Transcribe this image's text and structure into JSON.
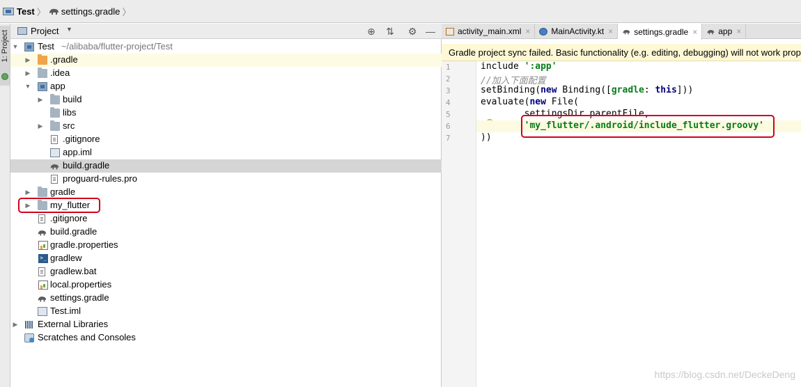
{
  "breadcrumb": {
    "project": "Test",
    "file": "settings.gradle"
  },
  "tool_strip": {
    "project_tab": "1: Project"
  },
  "project_panel": {
    "title": "Project",
    "tree": [
      {
        "label": "Test",
        "path": "~/alibaba/flutter-project/Test",
        "icon": "module-icon"
      },
      {
        "label": ".gradle",
        "icon": "folder-icon"
      },
      {
        "label": ".idea",
        "icon": "folder-icon"
      },
      {
        "label": "app",
        "icon": "module-icon"
      },
      {
        "label": "build",
        "icon": "folder-icon"
      },
      {
        "label": "libs",
        "icon": "folder-icon"
      },
      {
        "label": "src",
        "icon": "folder-icon"
      },
      {
        "label": ".gitignore",
        "icon": "text-file-icon"
      },
      {
        "label": "app.iml",
        "icon": "iml-file-icon"
      },
      {
        "label": "build.gradle",
        "icon": "gradle-elephant-icon"
      },
      {
        "label": "proguard-rules.pro",
        "icon": "text-file-icon"
      },
      {
        "label": "gradle",
        "icon": "folder-icon"
      },
      {
        "label": "my_flutter",
        "icon": "folder-icon"
      },
      {
        "label": ".gitignore",
        "icon": "text-file-icon"
      },
      {
        "label": "build.gradle",
        "icon": "gradle-elephant-icon"
      },
      {
        "label": "gradle.properties",
        "icon": "properties-file-icon"
      },
      {
        "label": "gradlew",
        "icon": "terminal-file-icon"
      },
      {
        "label": "gradlew.bat",
        "icon": "text-file-icon"
      },
      {
        "label": "local.properties",
        "icon": "properties-file-icon"
      },
      {
        "label": "settings.gradle",
        "icon": "gradle-elephant-icon"
      },
      {
        "label": "Test.iml",
        "icon": "iml-file-icon"
      },
      {
        "label": "External Libraries",
        "icon": "libraries-icon"
      },
      {
        "label": "Scratches and Consoles",
        "icon": "scratches-icon"
      }
    ]
  },
  "editor": {
    "tabs": [
      {
        "label": "activity_main.xml",
        "icon": "xml-file-icon"
      },
      {
        "label": "MainActivity.kt",
        "icon": "kotlin-file-icon"
      },
      {
        "label": "settings.gradle",
        "icon": "gradle-elephant-icon"
      },
      {
        "label": "app",
        "icon": "gradle-elephant-icon"
      }
    ],
    "sync_banner": "Gradle project sync failed. Basic functionality (e.g. editing, debugging) will not work properly.",
    "line_numbers": [
      "1",
      "2",
      "3",
      "4",
      "5",
      "6",
      "7"
    ],
    "code": {
      "l1_kw": "include ",
      "l1_str": "':app'",
      "l2": "//加入下面配置",
      "l3_a": "setBinding(",
      "l3_new": "new",
      "l3_b": " Binding([",
      "l3_gradle": "gradle",
      "l3_c": ": ",
      "l3_this": "this",
      "l3_d": "]))",
      "l4_a": "evaluate(",
      "l4_new": "new",
      "l4_b": " File(",
      "l5": "        settingsDir.parentFile,",
      "l6_str": "'my_flutter/.android/include_flutter.groovy'",
      "l7": "))"
    }
  },
  "watermark": "https://blog.csdn.net/DeckeDeng"
}
